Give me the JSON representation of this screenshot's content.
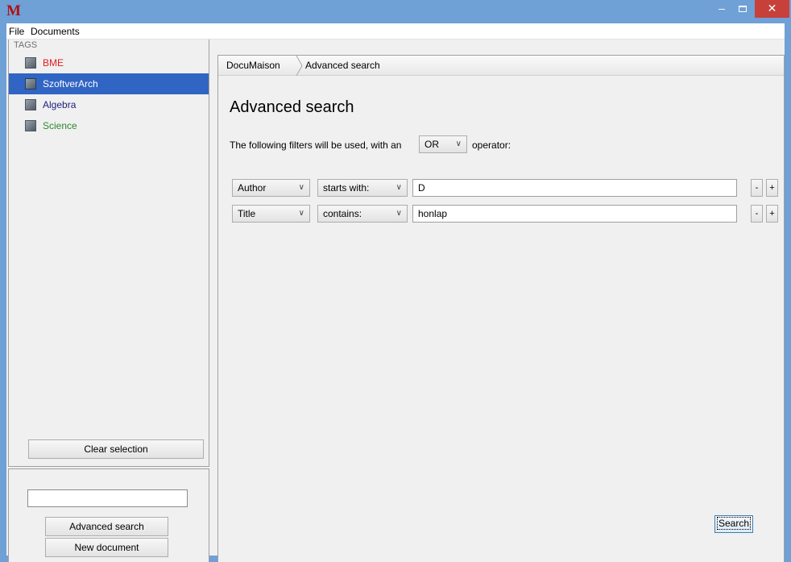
{
  "window": {
    "title_logo": "M",
    "minimize": "–",
    "close": "✕"
  },
  "menu": {
    "file": "File",
    "documents": "Documents"
  },
  "tags": {
    "header": "TAGS",
    "items": [
      {
        "label": "BME",
        "color": "#e02020",
        "selected": false
      },
      {
        "label": "SzoftverArch",
        "color": "#ffffff",
        "selected": true
      },
      {
        "label": "Algebra",
        "color": "#1d1d80",
        "selected": false
      },
      {
        "label": "Science",
        "color": "#2b8a2b",
        "selected": false
      }
    ],
    "clear_selection": "Clear selection"
  },
  "quick": {
    "search_value": "",
    "advanced_search": "Advanced search",
    "new_document": "New document"
  },
  "breadcrumb": {
    "items": [
      "DocuMaison",
      "Advanced search"
    ]
  },
  "main": {
    "title": "Advanced search",
    "intro_before": "The following filters will be used, with an",
    "operator": "OR",
    "intro_after": "operator:",
    "filters": [
      {
        "field": "Author",
        "condition": "starts with:",
        "value": "D"
      },
      {
        "field": "Title",
        "condition": "contains:",
        "value": "honlap"
      }
    ],
    "remove_label": "-",
    "add_label": "+",
    "search_button": "Search"
  }
}
